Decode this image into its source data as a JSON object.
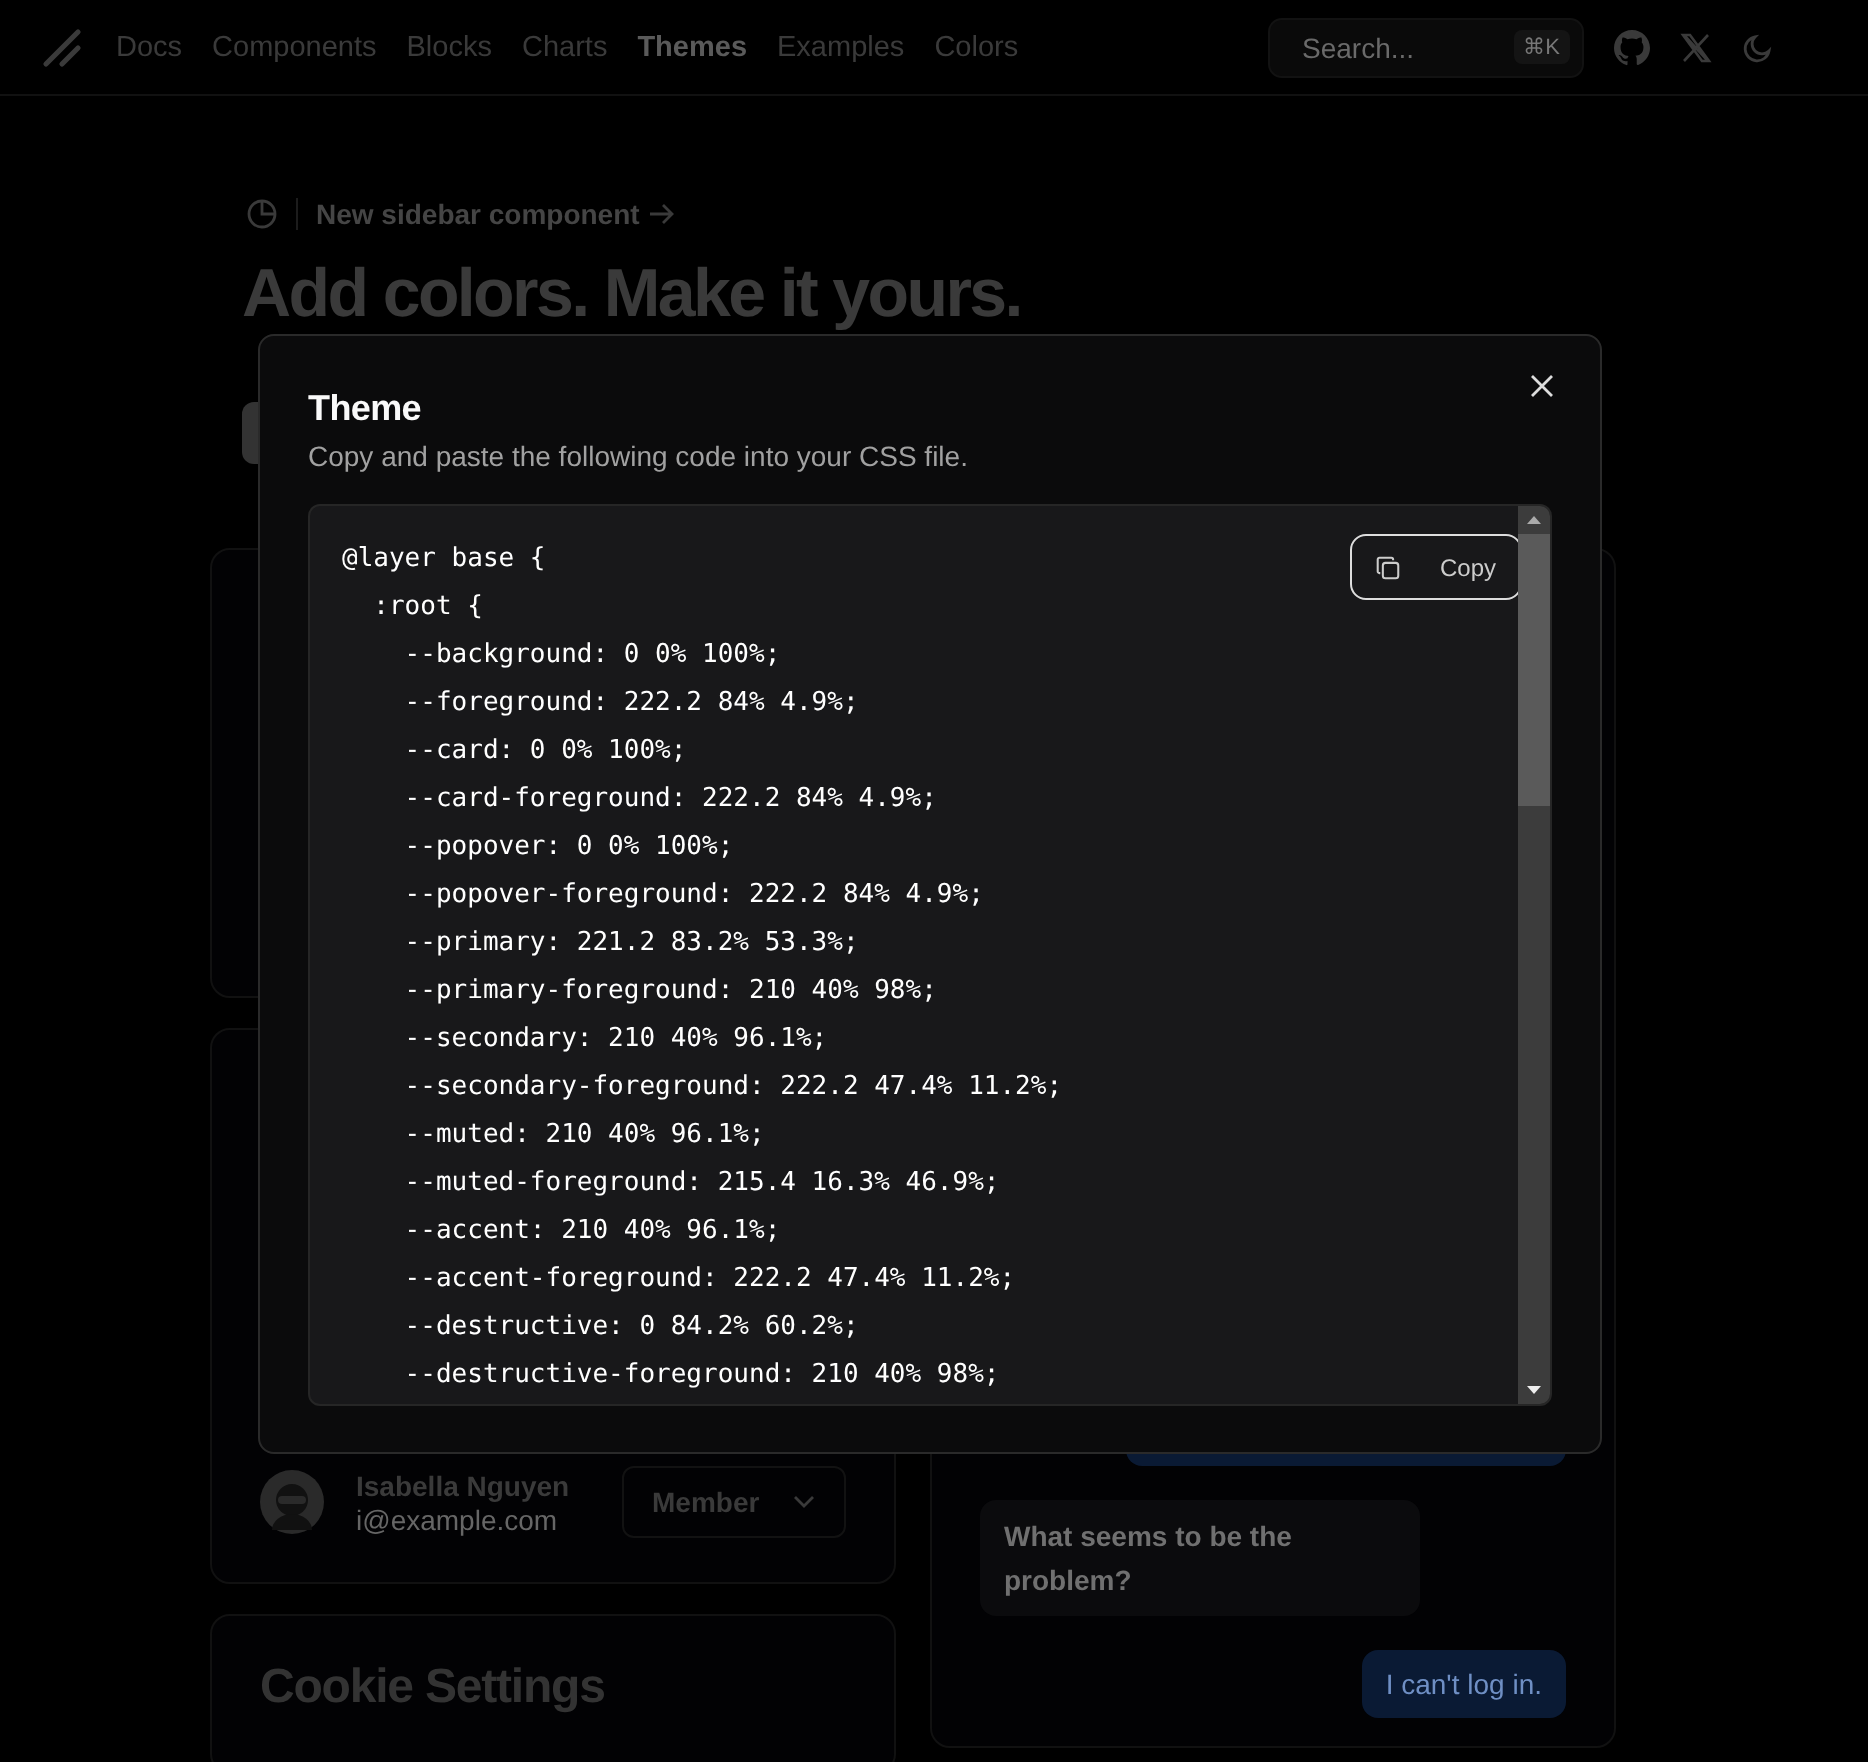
{
  "nav": {
    "links": [
      {
        "label": "Docs",
        "selected": false
      },
      {
        "label": "Components",
        "selected": false
      },
      {
        "label": "Blocks",
        "selected": false
      },
      {
        "label": "Charts",
        "selected": false
      },
      {
        "label": "Themes",
        "selected": true
      },
      {
        "label": "Examples",
        "selected": false
      },
      {
        "label": "Colors",
        "selected": false
      }
    ],
    "search": {
      "placeholder": "Search...",
      "shortcut": "⌘K"
    }
  },
  "hero": {
    "announcement": "New sidebar component",
    "heading": "Add colors. Make it yours."
  },
  "team_member": {
    "name": "Isabella Nguyen",
    "email": "i@example.com",
    "role": "Member"
  },
  "cookie_settings": {
    "title": "Cookie Settings"
  },
  "chat": {
    "messages": [
      {
        "kind": "outgoing"
      },
      {
        "kind": "incoming",
        "text": "What seems to be the problem?"
      },
      {
        "kind": "outgoing",
        "text": "I can't log in."
      }
    ]
  },
  "modal": {
    "title": "Theme",
    "description": "Copy and paste the following code into your CSS file.",
    "copy_label": "Copy",
    "code_lines": [
      "@layer base {",
      "  :root {",
      "    --background: 0 0% 100%;",
      "    --foreground: 222.2 84% 4.9%;",
      "    --card: 0 0% 100%;",
      "    --card-foreground: 222.2 84% 4.9%;",
      "    --popover: 0 0% 100%;",
      "    --popover-foreground: 222.2 84% 4.9%;",
      "    --primary: 221.2 83.2% 53.3%;",
      "    --primary-foreground: 210 40% 98%;",
      "    --secondary: 210 40% 96.1%;",
      "    --secondary-foreground: 222.2 47.4% 11.2%;",
      "    --muted: 210 40% 96.1%;",
      "    --muted-foreground: 215.4 16.3% 46.9%;",
      "    --accent: 210 40% 96.1%;",
      "    --accent-foreground: 222.2 47.4% 11.2%;",
      "    --destructive: 0 84.2% 60.2%;",
      "    --destructive-foreground: 210 40% 98%;"
    ]
  }
}
